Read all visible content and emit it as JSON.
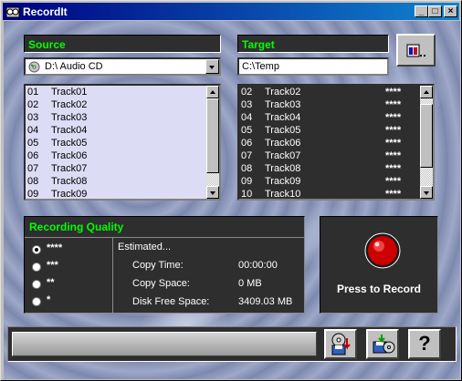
{
  "window": {
    "title": "RecordIt"
  },
  "source": {
    "header": "Source",
    "drive": "D:\\ Audio CD",
    "tracks": [
      {
        "num": "01",
        "name": "Track01"
      },
      {
        "num": "02",
        "name": "Track02"
      },
      {
        "num": "03",
        "name": "Track03"
      },
      {
        "num": "04",
        "name": "Track04"
      },
      {
        "num": "05",
        "name": "Track05"
      },
      {
        "num": "06",
        "name": "Track06"
      },
      {
        "num": "07",
        "name": "Track07"
      },
      {
        "num": "08",
        "name": "Track08"
      },
      {
        "num": "09",
        "name": "Track09"
      }
    ]
  },
  "target": {
    "header": "Target",
    "path": "C:\\Temp",
    "browse_icon": "folder-browse-icon",
    "tracks": [
      {
        "num": "02",
        "name": "Track02",
        "rating": "****"
      },
      {
        "num": "03",
        "name": "Track03",
        "rating": "****"
      },
      {
        "num": "04",
        "name": "Track04",
        "rating": "****"
      },
      {
        "num": "05",
        "name": "Track05",
        "rating": "****"
      },
      {
        "num": "06",
        "name": "Track06",
        "rating": "****"
      },
      {
        "num": "07",
        "name": "Track07",
        "rating": "****"
      },
      {
        "num": "08",
        "name": "Track08",
        "rating": "****"
      },
      {
        "num": "09",
        "name": "Track09",
        "rating": "****"
      },
      {
        "num": "10",
        "name": "Track10",
        "rating": "****"
      }
    ]
  },
  "quality": {
    "header": "Recording Quality",
    "options": [
      {
        "label": "****",
        "selected": true
      },
      {
        "label": "***",
        "selected": false
      },
      {
        "label": "**",
        "selected": false
      },
      {
        "label": "*",
        "selected": false
      }
    ],
    "estimated_label": "Estimated...",
    "copy_time_label": "Copy Time:",
    "copy_time_value": "00:00:00",
    "copy_space_label": "Copy Space:",
    "copy_space_value": "0 MB",
    "disk_free_label": "Disk Free Space:",
    "disk_free_value": "3409.03 MB"
  },
  "record": {
    "label": "Press to Record"
  },
  "toolbar": {
    "icons": [
      "cd-to-disk-icon",
      "disk-to-cd-icon",
      "help-icon"
    ],
    "help_glyph": "?"
  },
  "colors": {
    "header_text": "#00ff00",
    "panel_bg": "#2e2e2e",
    "list_bg": "#dcdcf5",
    "title_gradient_start": "#000080"
  }
}
